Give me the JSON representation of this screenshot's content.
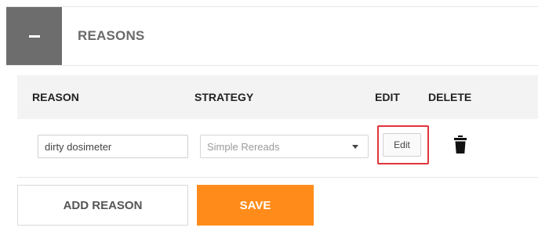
{
  "section": {
    "title": "REASONS",
    "collapse_icon": "minus-icon"
  },
  "table": {
    "columns": [
      "REASON",
      "STRATEGY",
      "EDIT",
      "DELETE"
    ],
    "rows": [
      {
        "reason": "dirty dosimeter",
        "strategy": "Simple Rereads",
        "edit_label": "Edit",
        "delete_icon": "trash-icon"
      }
    ]
  },
  "actions": {
    "add_reason_label": "ADD REASON",
    "save_label": "SAVE"
  },
  "colors": {
    "accent": "#ff8c1a",
    "highlight": "#e0353b",
    "collapse_bg": "#6d6d6d"
  }
}
